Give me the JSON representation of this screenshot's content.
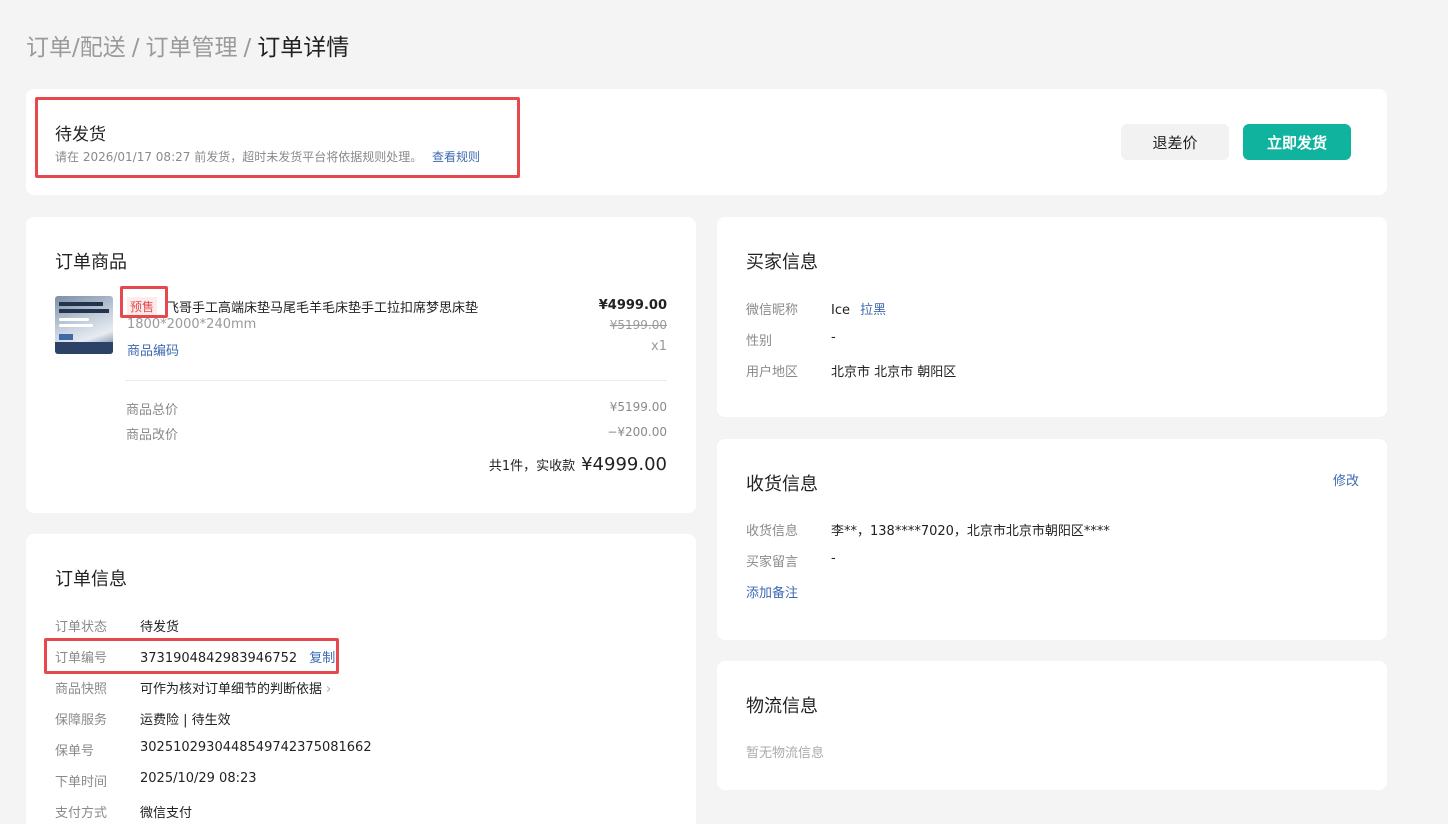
{
  "breadcrumb": {
    "level1": "订单/配送",
    "level2": "订单管理",
    "current": "订单详情",
    "separator": "/"
  },
  "status": {
    "title": "待发货",
    "desc": "请在 2026/01/17 08:27 前发货，超时未发货平台将依据规则处理。",
    "rules_link": "查看规则",
    "refund_button": "退差价",
    "ship_button": "立即发货"
  },
  "products": {
    "title": "订单商品",
    "tag": "预售",
    "name": "飞哥手工高端床垫马尾毛羊毛床垫手工拉扣席梦思床垫",
    "spec": "1800*2000*240mm",
    "code_link": "商品编码",
    "price": "¥4999.00",
    "original_price": "¥5199.00",
    "quantity": "x1",
    "subtotal_label": "商品总价",
    "subtotal_value": "¥5199.00",
    "adjust_label": "商品改价",
    "adjust_value": "−¥200.00",
    "total_label": "共1件，实收款",
    "total_value": "¥4999.00"
  },
  "order_info": {
    "title": "订单信息",
    "status_label": "订单状态",
    "status_value": "待发货",
    "number_label": "订单编号",
    "number_value": "3731904842983946752",
    "copy_link": "复制",
    "snapshot_label": "商品快照",
    "snapshot_value": "可作为核对订单细节的判断依据",
    "service_label": "保障服务",
    "service_value": "运费险 | 待生效",
    "policy_label": "保单号",
    "policy_value": "30251029304485497423750816​62",
    "time_label": "下单时间",
    "time_value": "2025/10/29 08:23",
    "pay_label": "支付方式",
    "pay_value": "微信支付"
  },
  "buyer": {
    "title": "买家信息",
    "nickname_label": "微信昵称",
    "nickname_value": "Ice",
    "block_link": "拉黑",
    "gender_label": "性别",
    "gender_value": "-",
    "region_label": "用户地区",
    "region_value": "北京市 北京市 朝阳区"
  },
  "shipping": {
    "title": "收货信息",
    "edit_link": "修改",
    "address_label": "收货信息",
    "address_value": "李**，138****7020，北京市北京市朝阳区****",
    "message_label": "买家留言",
    "message_value": "-",
    "note_link": "添加备注"
  },
  "logistics": {
    "title": "物流信息",
    "empty": "暂无物流信息"
  },
  "colors": {
    "primary": "#10b39d",
    "link": "#3d6ab0",
    "highlight": "#e5494d"
  }
}
